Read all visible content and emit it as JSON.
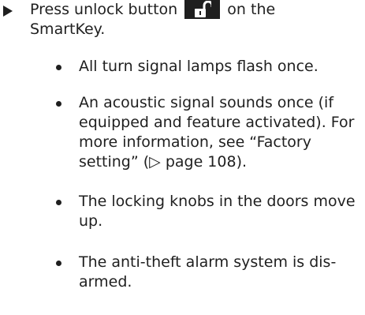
{
  "step": {
    "before": "Press unlock button",
    "icon": "unlock-icon",
    "after": "on the SmartKey."
  },
  "bullets": [
    {
      "text": "All turn signal lamps flash once."
    },
    {
      "text": "An acoustic signal sounds once (if equipped and feature activated). For more information, see “Factory setting” (▷ page 108)."
    },
    {
      "text": "The locking knobs in the doors move up."
    },
    {
      "text": "The anti-theft alarm system is dis-armed."
    }
  ]
}
